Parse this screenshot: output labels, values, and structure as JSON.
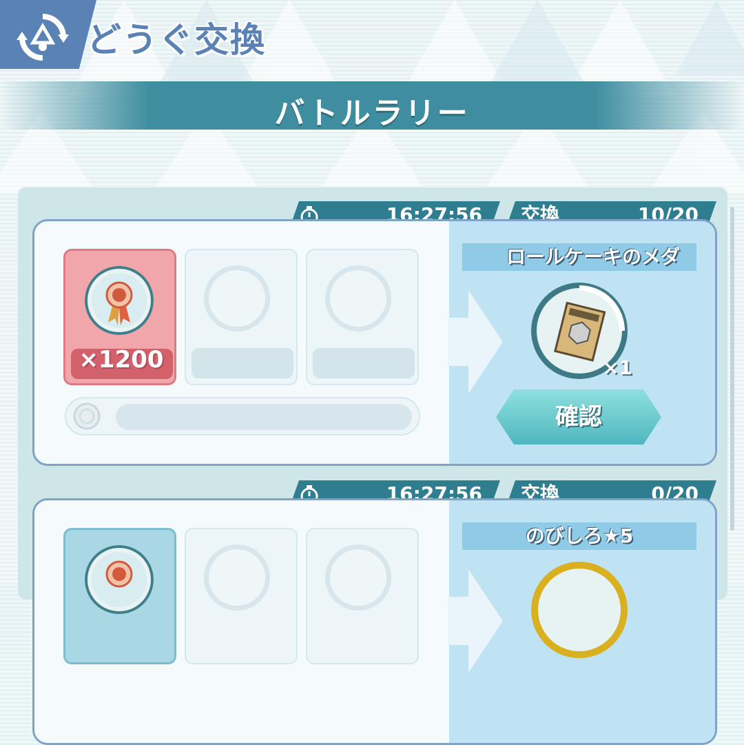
{
  "header": {
    "title": "どうぐ交換",
    "icon": "exchange-icon"
  },
  "banner": {
    "title": "バトルラリー"
  },
  "colors": {
    "accent": "#2f7e8f",
    "header_blue": "#5a82b4",
    "slot_red": "#f0a6aa",
    "slot_blue": "#a9d8e4"
  },
  "cards": [
    {
      "timer": "16:27:56",
      "exchange_label": "交換",
      "exchange_count": "10/20",
      "cost_qty": "×1200",
      "reward_name": "ロールケーキのメダ",
      "reward_qty": "×1",
      "confirm_label": "確認"
    },
    {
      "timer": "16:27:56",
      "exchange_label": "交換",
      "exchange_count": "0/20",
      "reward_name": "のびしろ★5"
    }
  ]
}
